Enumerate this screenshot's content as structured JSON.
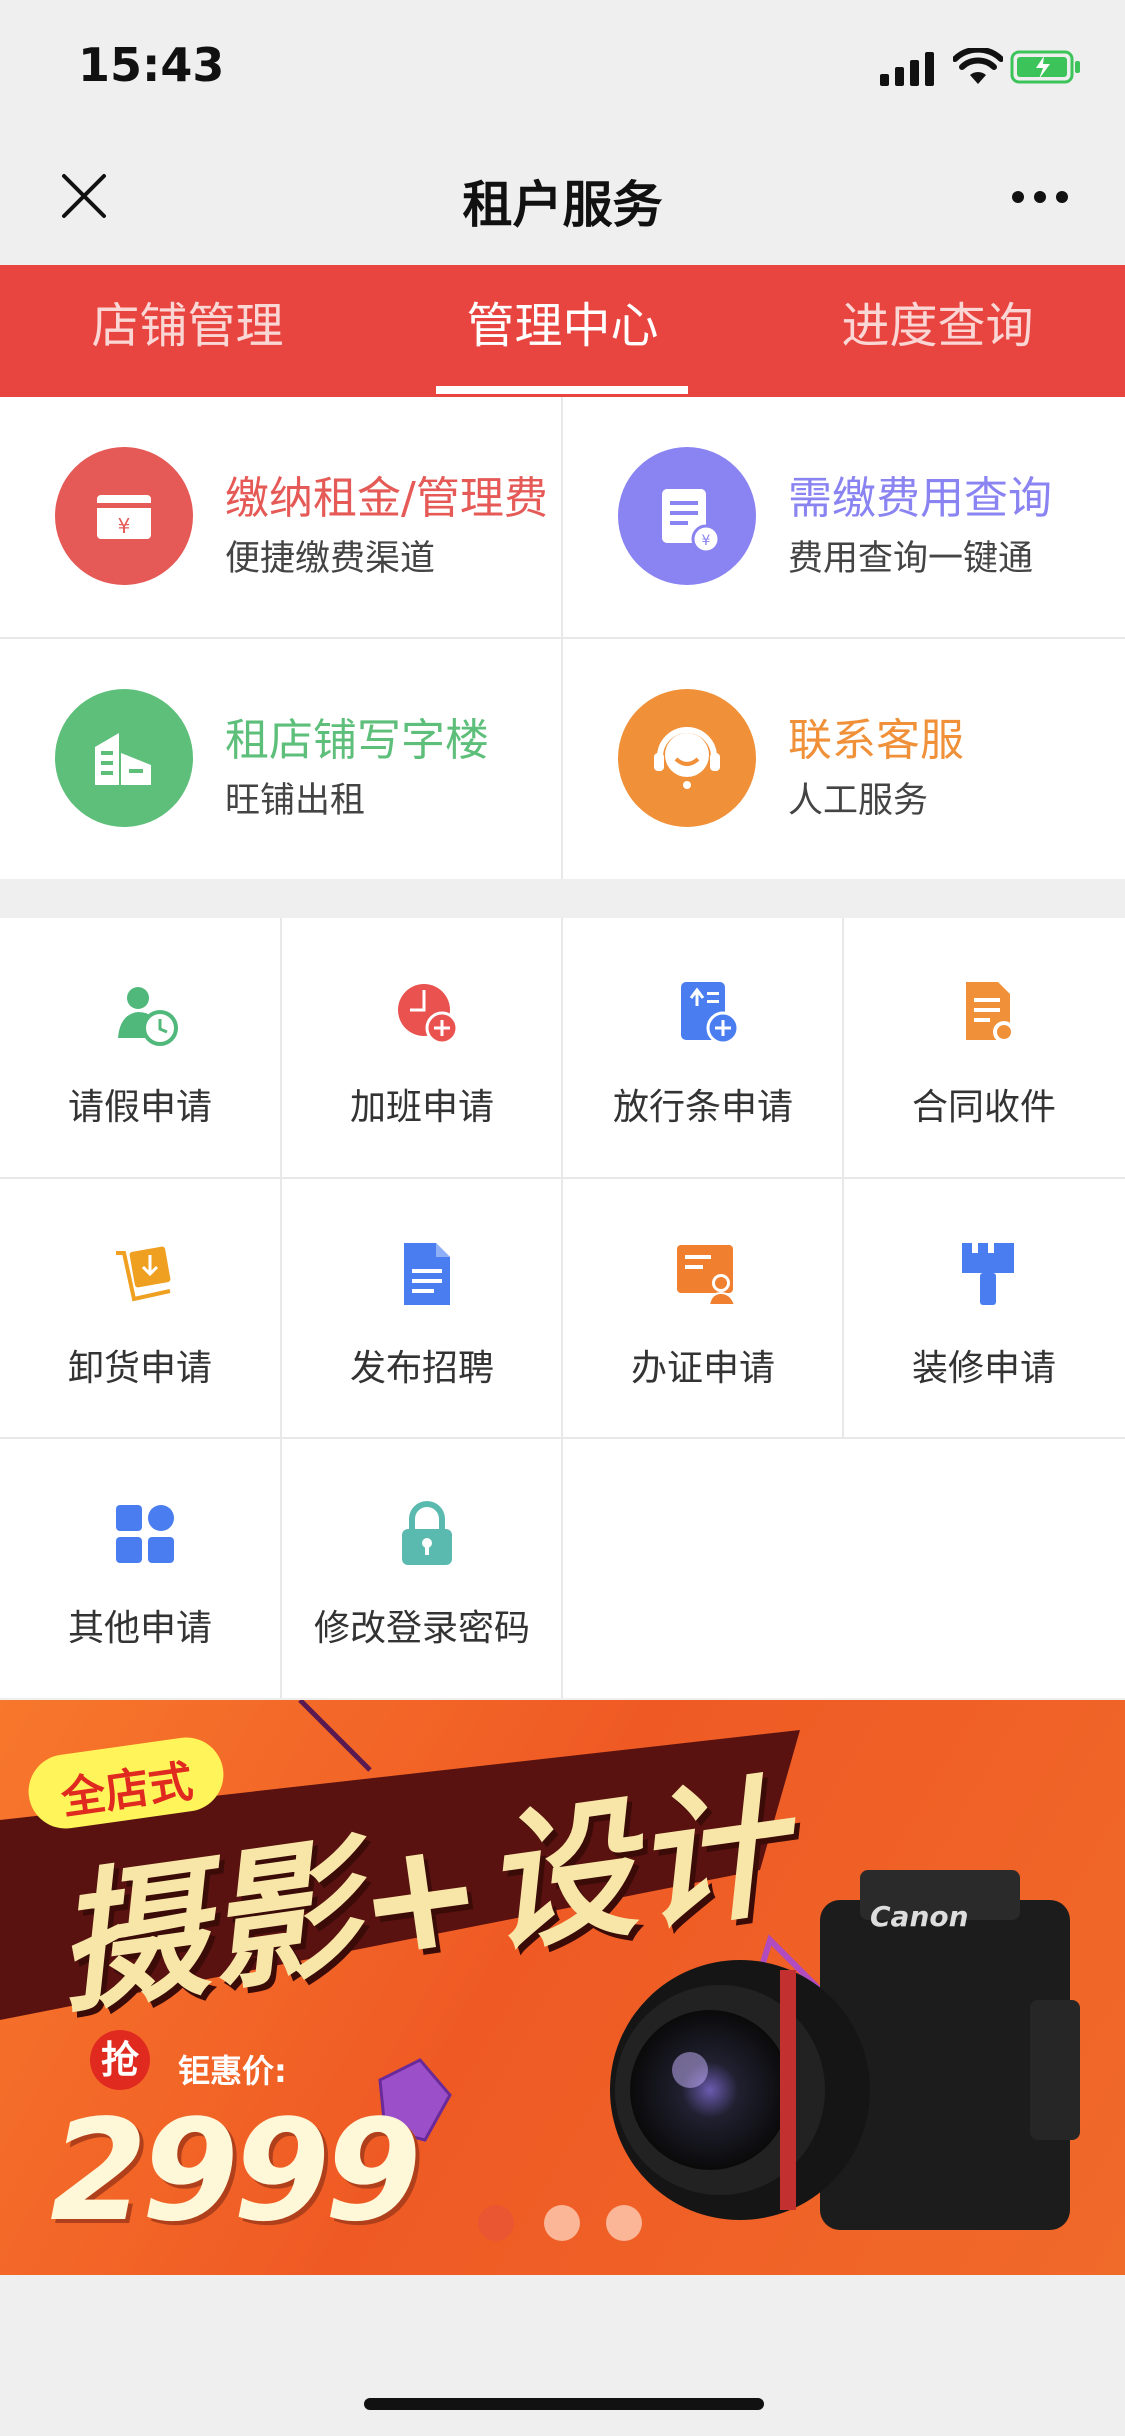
{
  "status": {
    "time": "15:43"
  },
  "nav": {
    "title": "租户服务"
  },
  "tabs": [
    {
      "label": "店铺管理",
      "active": false
    },
    {
      "label": "管理中心",
      "active": true
    },
    {
      "label": "进度查询",
      "active": false
    }
  ],
  "services": [
    {
      "title": "缴纳租金/管理费",
      "subtitle": "便捷缴费渠道",
      "color": "#e55a57",
      "icon": "payment-card-icon"
    },
    {
      "title": "需缴费用查询",
      "subtitle": "费用查询一键通",
      "color": "#8a83f2",
      "icon": "bill-query-icon"
    },
    {
      "title": "租店铺写字楼",
      "subtitle": "旺铺出租",
      "color": "#5ebf7b",
      "icon": "building-icon"
    },
    {
      "title": "联系客服",
      "subtitle": "人工服务",
      "color": "#f0913a",
      "icon": "headset-icon"
    }
  ],
  "grid": [
    {
      "label": "请假申请",
      "icon": "leave-clock-icon"
    },
    {
      "label": "加班申请",
      "icon": "overtime-plus-icon"
    },
    {
      "label": "放行条申请",
      "icon": "release-slip-icon"
    },
    {
      "label": "合同收件",
      "icon": "contract-icon"
    },
    {
      "label": "卸货申请",
      "icon": "unload-icon"
    },
    {
      "label": "发布招聘",
      "icon": "recruit-doc-icon"
    },
    {
      "label": "办证申请",
      "icon": "certificate-icon"
    },
    {
      "label": "装修申请",
      "icon": "paint-brush-icon"
    },
    {
      "label": "其他申请",
      "icon": "apps-icon"
    },
    {
      "label": "修改登录密码",
      "icon": "lock-icon"
    }
  ],
  "banner": {
    "tag": "全店式",
    "headline": "摄影+设计",
    "grab": "抢",
    "price_label": "钜惠价:",
    "price": "2999",
    "camera_brand": "Canon",
    "slides": 3,
    "active_slide": 0
  },
  "colors": {
    "accent": "#e84540",
    "grid_blue": "#4a7ef0",
    "grid_green": "#4fb87a",
    "grid_red": "#e9524f",
    "grid_orange": "#f0913a",
    "grid_teal": "#5bbab0"
  }
}
